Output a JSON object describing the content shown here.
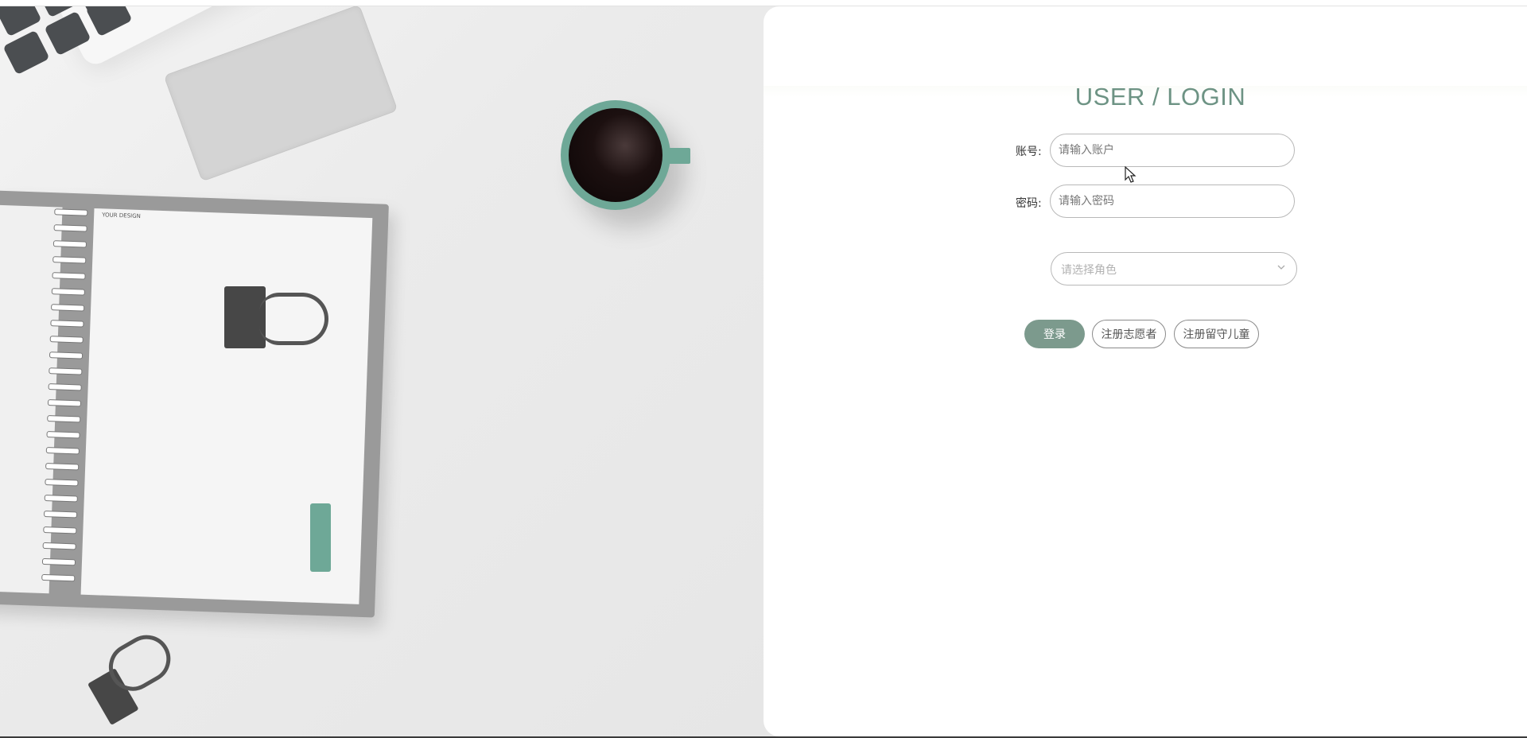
{
  "login": {
    "title": "USER / LOGIN",
    "account_label": "账号:",
    "account_placeholder": "请输入账户",
    "password_label": "密码:",
    "password_placeholder": "请输入密码",
    "role_placeholder": "请选择角色",
    "login_button": "登录",
    "register_volunteer_button": "注册志愿者",
    "register_child_button": "注册留守儿童"
  },
  "background": {
    "notebook_text": "YOUR DESIGN"
  },
  "colors": {
    "accent": "#7c9a8d",
    "title": "#6d9384",
    "teal_decor": "#6ea897"
  },
  "icons": {
    "select_arrow": "chevron-down-icon",
    "cursor": "mouse-pointer-icon"
  }
}
